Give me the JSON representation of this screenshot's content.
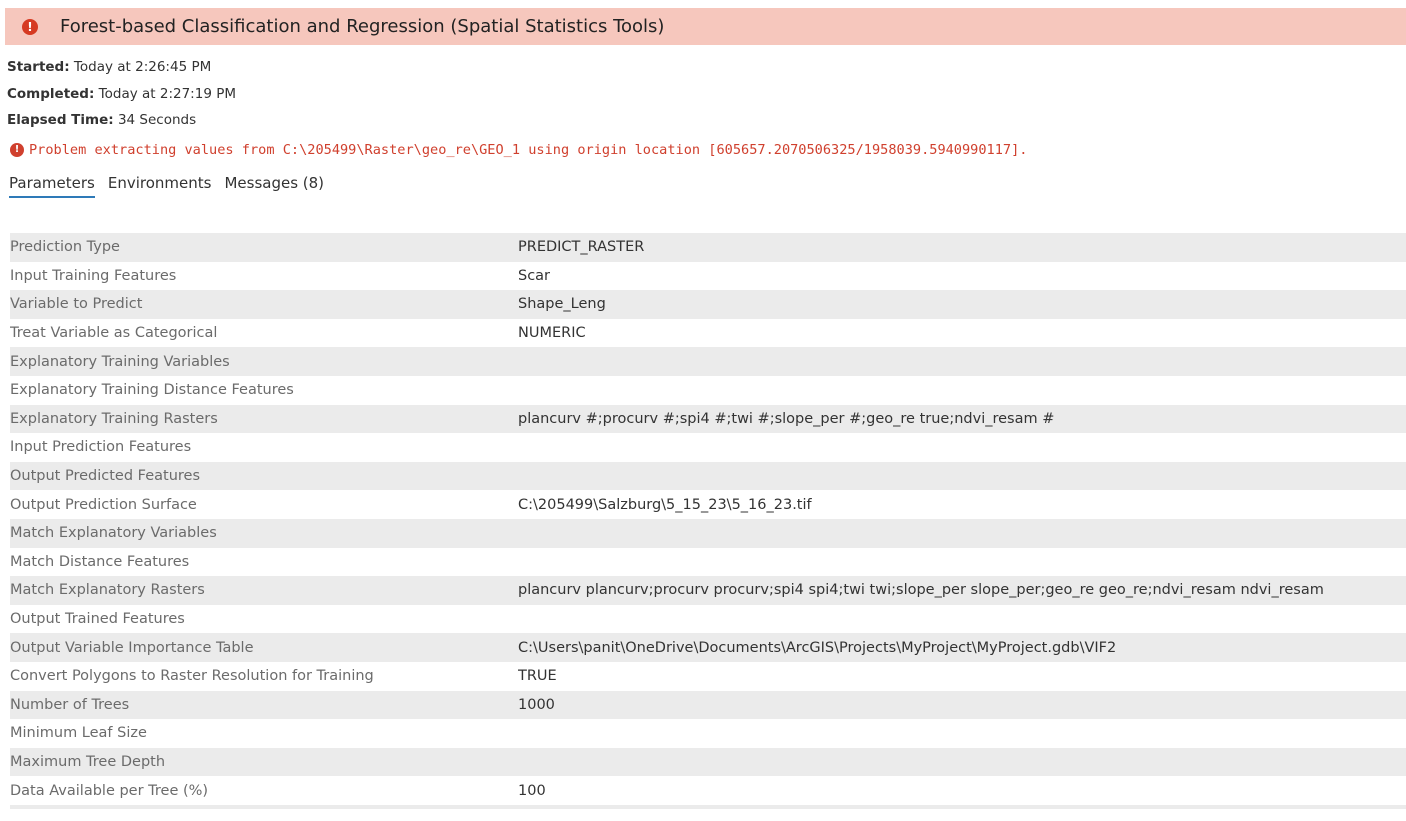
{
  "header": {
    "icon": "error-icon",
    "title": "Forest-based Classification and Regression (Spatial Statistics Tools)",
    "background_color": "#f6c7bd"
  },
  "meta": {
    "started_label": "Started:",
    "started_value": "Today at 2:26:45 PM",
    "completed_label": "Completed:",
    "completed_value": "Today at 2:27:19 PM",
    "elapsed_label": "Elapsed Time:",
    "elapsed_value": "34 Seconds"
  },
  "error": {
    "icon": "error-icon",
    "message": "Problem extracting values from C:\\205499\\Raster\\geo_re\\GEO_1 using origin location [605657.2070506325/1958039.5940990117].",
    "color": "#d0402e"
  },
  "tabs": [
    {
      "label": "Parameters",
      "active": true
    },
    {
      "label": "Environments",
      "active": false
    },
    {
      "label": "Messages (8)",
      "active": false
    }
  ],
  "accent_color": "#2e7ab8",
  "parameters": [
    {
      "name": "Prediction Type",
      "value": "PREDICT_RASTER"
    },
    {
      "name": "Input Training Features",
      "value": "Scar"
    },
    {
      "name": "Variable to Predict",
      "value": "Shape_Leng"
    },
    {
      "name": "Treat Variable as Categorical",
      "value": "NUMERIC"
    },
    {
      "name": "Explanatory Training Variables",
      "value": ""
    },
    {
      "name": "Explanatory Training Distance Features",
      "value": ""
    },
    {
      "name": "Explanatory Training Rasters",
      "value": "plancurv #;procurv #;spi4 #;twi #;slope_per #;geo_re true;ndvi_resam #"
    },
    {
      "name": "Input Prediction Features",
      "value": ""
    },
    {
      "name": "Output Predicted Features",
      "value": ""
    },
    {
      "name": "Output Prediction Surface",
      "value": "C:\\205499\\Salzburg\\5_15_23\\5_16_23.tif"
    },
    {
      "name": "Match Explanatory Variables",
      "value": ""
    },
    {
      "name": "Match Distance Features",
      "value": ""
    },
    {
      "name": "Match Explanatory Rasters",
      "value": "plancurv plancurv;procurv procurv;spi4 spi4;twi twi;slope_per slope_per;geo_re geo_re;ndvi_resam ndvi_resam"
    },
    {
      "name": "Output Trained Features",
      "value": ""
    },
    {
      "name": "Output Variable Importance Table",
      "value": "C:\\Users\\panit\\OneDrive\\Documents\\ArcGIS\\Projects\\MyProject\\MyProject.gdb\\VIF2"
    },
    {
      "name": "Convert Polygons to Raster Resolution for Training",
      "value": "TRUE"
    },
    {
      "name": "Number of Trees",
      "value": "1000"
    },
    {
      "name": "Minimum Leaf Size",
      "value": ""
    },
    {
      "name": "Maximum Tree Depth",
      "value": ""
    },
    {
      "name": "Data Available per Tree (%)",
      "value": "100"
    }
  ]
}
